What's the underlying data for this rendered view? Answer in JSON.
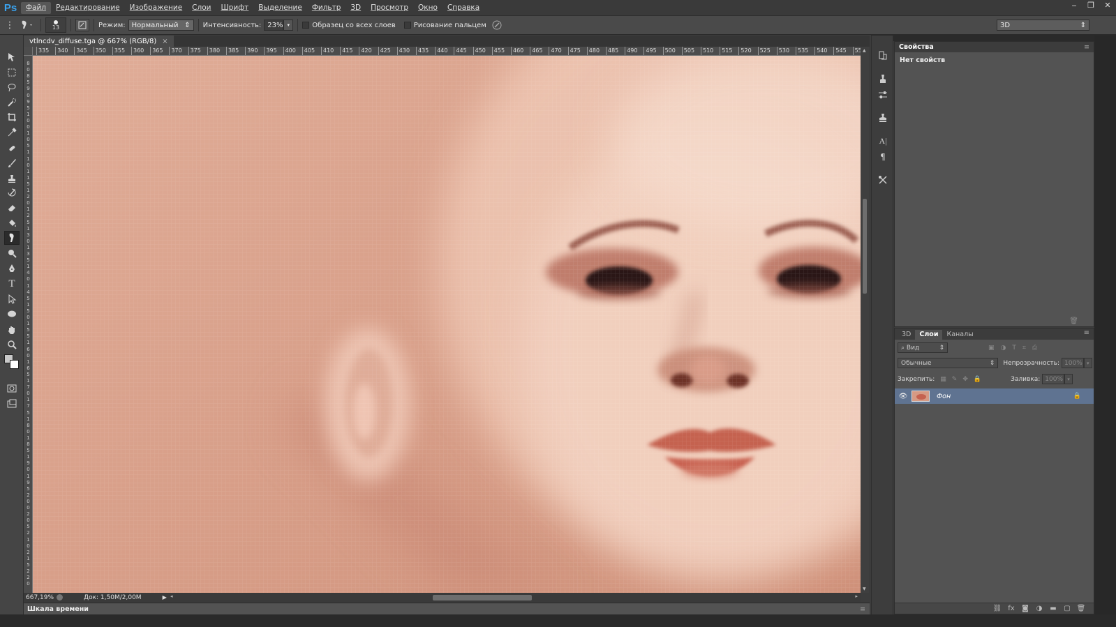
{
  "app": {
    "logo": "Ps"
  },
  "menu": [
    "Файл",
    "Редактирование",
    "Изображение",
    "Слои",
    "Шрифт",
    "Выделение",
    "Фильтр",
    "3D",
    "Просмотр",
    "Окно",
    "Справка"
  ],
  "window_controls": {
    "minimize": "‒",
    "restore": "❐",
    "close": "✕"
  },
  "options": {
    "brush_size": "13",
    "mode_label": "Режим:",
    "mode_value": "Нормальный",
    "intensity_label": "Интенсивность:",
    "intensity_value": "23%",
    "sample_all_layers": "Образец со всех слоев",
    "finger_painting": "Рисование пальцем",
    "workspace": "3D"
  },
  "document": {
    "tab_title": "vtlncdv_diffuse.tga @ 667% (RGB/8)",
    "close_glyph": "×",
    "zoom": "667,19%",
    "doc_size": "Док: 1,50M/2,00M"
  },
  "ruler_top": [
    "335",
    "340",
    "345",
    "350",
    "355",
    "360",
    "365",
    "370",
    "375",
    "380",
    "385",
    "390",
    "395",
    "400",
    "405",
    "410",
    "415",
    "420",
    "425",
    "430",
    "435",
    "440",
    "445",
    "450",
    "455",
    "460",
    "465",
    "470",
    "475",
    "480",
    "485",
    "490",
    "495",
    "500",
    "505",
    "510",
    "515",
    "520",
    "525",
    "530",
    "535",
    "540",
    "545",
    "55"
  ],
  "ruler_left": [
    "8",
    "0",
    "8",
    "5",
    "9",
    "0",
    "9",
    "5",
    "1",
    "0",
    "0",
    "1",
    "0",
    "5",
    "1",
    "1",
    "0",
    "1",
    "1",
    "5",
    "1",
    "2",
    "0",
    "1",
    "2",
    "5",
    "1",
    "3",
    "0",
    "1",
    "3",
    "5",
    "1",
    "4",
    "0",
    "1",
    "4",
    "5",
    "1",
    "5",
    "0",
    "1",
    "5",
    "5",
    "1",
    "6",
    "0",
    "1",
    "6",
    "5",
    "1",
    "7",
    "0",
    "1",
    "7",
    "5",
    "1",
    "8",
    "0",
    "1",
    "8",
    "5",
    "1",
    "9",
    "0",
    "1",
    "9",
    "5",
    "2",
    "0",
    "0",
    "2",
    "0",
    "5",
    "2",
    "1",
    "0",
    "2",
    "1",
    "5",
    "2",
    "2",
    "0"
  ],
  "timeline": {
    "label": "Шкала времени"
  },
  "properties": {
    "title": "Свойства",
    "body": "Нет свойств"
  },
  "layers": {
    "tabs": [
      "3D",
      "Слои",
      "Каналы"
    ],
    "active_tab": "Слои",
    "filter_value": "Вид",
    "blend_mode": "Обычные",
    "opacity_label": "Непрозрачность:",
    "opacity_value": "100%",
    "lock_label": "Закрепить:",
    "fill_label": "Заливка:",
    "fill_value": "100%",
    "items": [
      {
        "name": "Фон",
        "visible": true,
        "locked": true
      }
    ]
  },
  "colors": {
    "accent_ps": "#3aa3ef",
    "skin": "#d69a84",
    "selected_layer": "#5f7391",
    "panel": "#535353"
  }
}
